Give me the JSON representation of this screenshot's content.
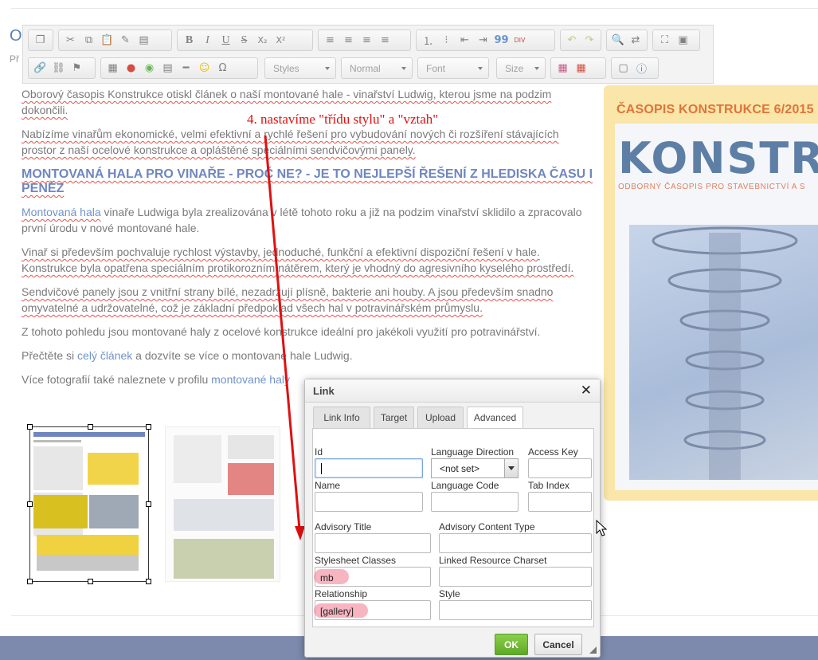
{
  "page": {
    "heading_partial": "O",
    "sub_partial": "Př"
  },
  "toolbar": {
    "styles": "Styles",
    "format": "Normal",
    "font": "Font",
    "size": "Size",
    "subscript": "X₂",
    "superscript": "X²",
    "bold": "B",
    "italic": "I",
    "underline": "U",
    "strike": "S",
    "omega": "Ω",
    "quote": "99",
    "div": "DIV"
  },
  "annotation": "4. nastavíme \"třídu stylu\" a \"vztah\"",
  "article": {
    "p1": "Oborový časopis Konstrukce otiskl článek o naší montované hale - vinařství Ludwig, kterou jsme na podzim dokončili.",
    "p2": "Nabízíme vinařům ekonomické, velmi efektivní a rychlé řešení pro vybudování nových či rozšíření stávajících prostor z naší ocelové konstrukce a opláštěné speciálními sendvičovými panely.",
    "heading": "Montovaná hala pro vinaře - proč ne? - je to nejlepší řešení z hlediska času i peněz",
    "p3_link": "Montovaná hala",
    "p3_rest": " vinaře Ludwiga byla zrealizována v létě tohoto roku a již na podzim vinařství sklidilo a zpracovalo první úrodu v nové montované hale.",
    "p4": "Vinař si především pochvaluje rychlost výstavby, jednoduché, funkční a efektivní dispoziční řešení v hale. Konstrukce byla opatřena speciálním protikorozním nátěrem, který je vhodný do agresivního kyselého prostředí.",
    "p5": "Sendvičové panely jsou z vnitřní strany bílé, nezadržují plísně, bakterie ani houby. A jsou především snadno omyvatelné a udržovatelné, což je základní předpoklad všech hal v potravinářském průmyslu.",
    "p6": "Z tohoto pohledu jsou montované haly z ocelové konstrukce ideální pro jakékoli využití pro potravinářství.",
    "p7_a": "Přečtěte si ",
    "p7_link": "celý článek",
    "p7_b": " a dozvíte se více o montované hale Ludwig.",
    "p8_a": "Více fotografií také naleznete v profilu ",
    "p8_link": "montované haly"
  },
  "cover": {
    "title": "ČASOPIS KONSTRUKCE 6/2015",
    "logo": "KONSTRUK",
    "tagline": "ODBORNÝ ČASOPIS PRO STAVEBNICTVÍ A S"
  },
  "dialog": {
    "title": "Link",
    "close": "✕",
    "tabs": [
      "Link Info",
      "Target",
      "Upload",
      "Advanced"
    ],
    "active_tab": "Advanced",
    "fields": {
      "id_label": "Id",
      "id_value": "",
      "lang_dir_label": "Language Direction",
      "lang_dir_value": "<not set>",
      "access_key_label": "Access Key",
      "name_label": "Name",
      "lang_code_label": "Language Code",
      "tab_index_label": "Tab Index",
      "advisory_title_label": "Advisory Title",
      "advisory_ct_label": "Advisory Content Type",
      "stylesheet_label": "Stylesheet Classes",
      "stylesheet_value": "mb",
      "charset_label": "Linked Resource Charset",
      "relationship_label": "Relationship",
      "relationship_value": "[gallery]",
      "style_label": "Style"
    },
    "ok": "OK",
    "cancel": "Cancel"
  },
  "colors": {
    "accent_link": "#6f93c9",
    "annotation": "#e01010",
    "ok_button": "#6ab52f",
    "cover_bg": "#f9e6a8",
    "cover_title": "#e0733a"
  }
}
